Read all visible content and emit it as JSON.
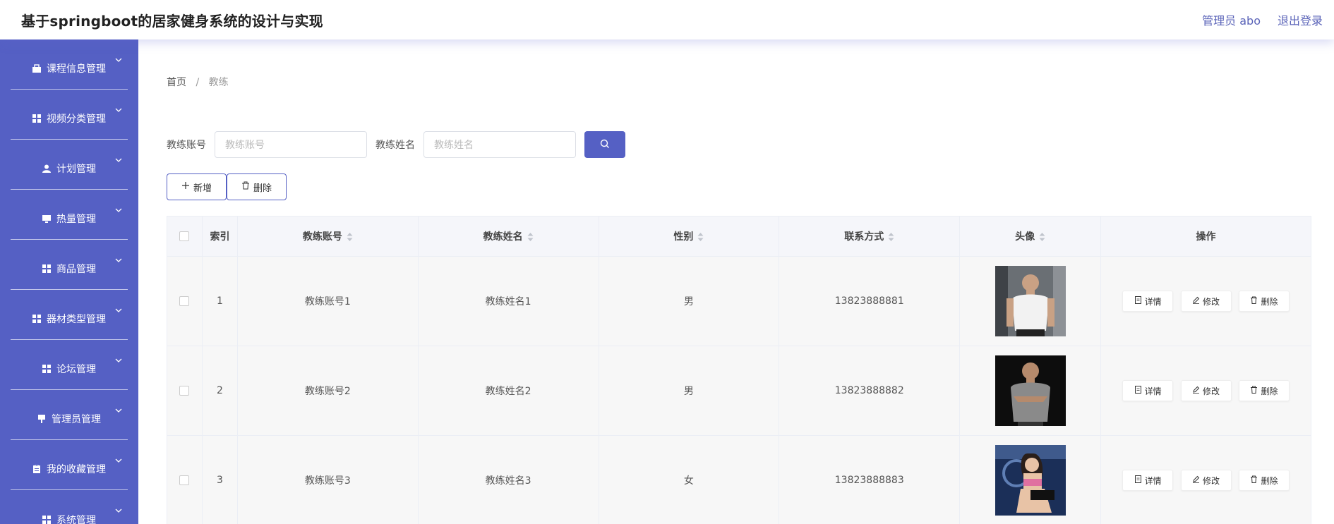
{
  "app": {
    "title": "基于springboot的居家健身系统的设计与实现"
  },
  "header": {
    "user_label": "管理员 abo",
    "logout_label": "退出登录"
  },
  "sidebar": {
    "items": [
      {
        "label": "课程信息管理",
        "icon": "briefcase-icon"
      },
      {
        "label": "视频分类管理",
        "icon": "grid-icon"
      },
      {
        "label": "计划管理",
        "icon": "user-icon"
      },
      {
        "label": "热量管理",
        "icon": "monitor-icon"
      },
      {
        "label": "商品管理",
        "icon": "grid-icon"
      },
      {
        "label": "器材类型管理",
        "icon": "grid-icon"
      },
      {
        "label": "论坛管理",
        "icon": "grid-icon"
      },
      {
        "label": "管理员管理",
        "icon": "stamp-icon"
      },
      {
        "label": "我的收藏管理",
        "icon": "clipboard-icon"
      },
      {
        "label": "系统管理",
        "icon": "grid-icon"
      }
    ]
  },
  "breadcrumb": {
    "home": "首页",
    "separator": "/",
    "current": "教练"
  },
  "search": {
    "account_label": "教练账号",
    "account_placeholder": "教练账号",
    "name_label": "教练姓名",
    "name_placeholder": "教练姓名"
  },
  "actions": {
    "add_label": "新增",
    "delete_label": "删除"
  },
  "table": {
    "columns": [
      "索引",
      "教练账号",
      "教练姓名",
      "性别",
      "联系方式",
      "头像",
      "操作"
    ],
    "rows": [
      {
        "index": "1",
        "account": "教练账号1",
        "name": "教练姓名1",
        "gender": "男",
        "phone": "13823888881"
      },
      {
        "index": "2",
        "account": "教练账号2",
        "name": "教练姓名2",
        "gender": "男",
        "phone": "13823888882"
      },
      {
        "index": "3",
        "account": "教练账号3",
        "name": "教练姓名3",
        "gender": "女",
        "phone": "13823888883"
      }
    ],
    "row_actions": {
      "detail": "详情",
      "edit": "修改",
      "delete": "删除"
    }
  },
  "colors": {
    "primary": "#5560c4",
    "sidebar_bg": "#5560c4"
  }
}
